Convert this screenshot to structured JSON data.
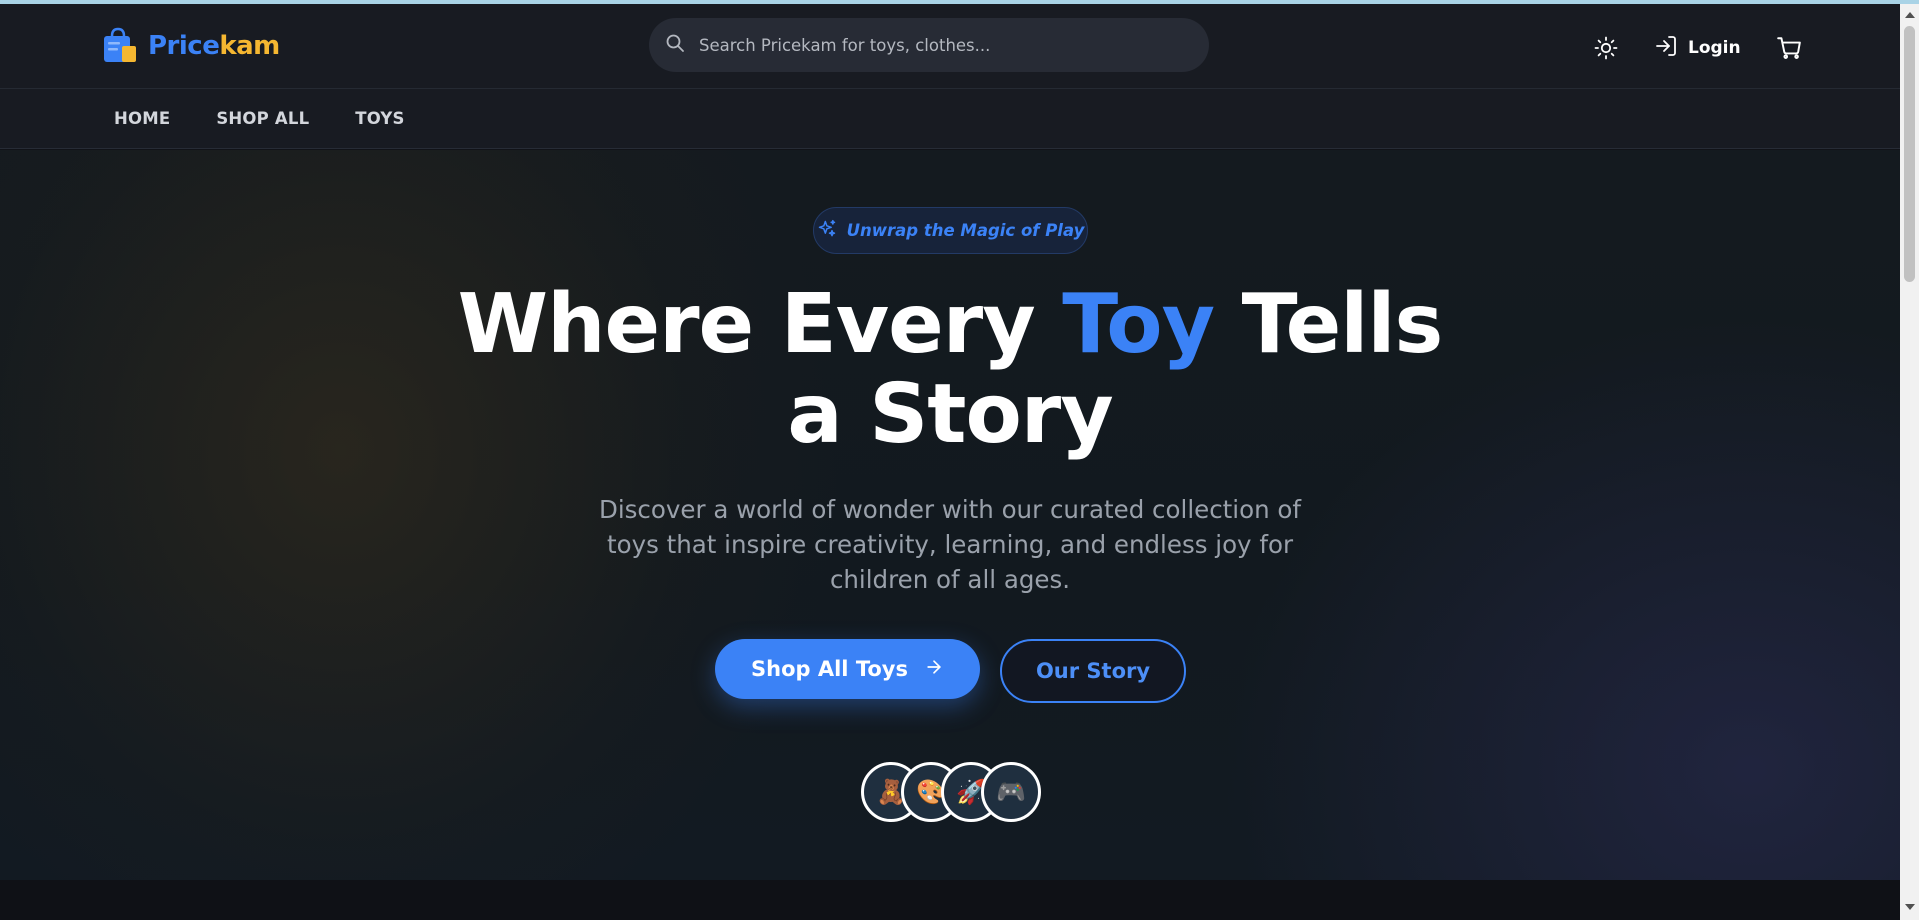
{
  "brand": {
    "name_part1": "Price",
    "name_part2": "kam",
    "colors": {
      "primary": "#3b82f6",
      "accent": "#f5b731"
    }
  },
  "header": {
    "search": {
      "placeholder": "Search Pricekam for toys, clothes..."
    },
    "login_label": "Login",
    "icons": [
      "shopping-bag-icon",
      "search-icon",
      "sun-icon",
      "login-icon",
      "cart-icon"
    ]
  },
  "nav": {
    "items": [
      {
        "label": "HOME"
      },
      {
        "label": "SHOP ALL"
      },
      {
        "label": "TOYS"
      }
    ]
  },
  "hero": {
    "badge": "Unwrap the Magic of Play",
    "headline": {
      "part1": "Where Every ",
      "accent": "Toy",
      "part2": " Tells",
      "line2": "a Story"
    },
    "subtitle": "Discover a world of wonder with our curated collection of toys that inspire creativity, learning, and endless joy for children of all ages.",
    "primary_button": "Shop All Toys",
    "secondary_button": "Our Story",
    "avatars": [
      {
        "emoji": "🧸",
        "name": "teddy-bear"
      },
      {
        "emoji": "🎨",
        "name": "palette"
      },
      {
        "emoji": "🚀",
        "name": "rocket"
      },
      {
        "emoji": "🎮",
        "name": "game-controller"
      }
    ]
  }
}
